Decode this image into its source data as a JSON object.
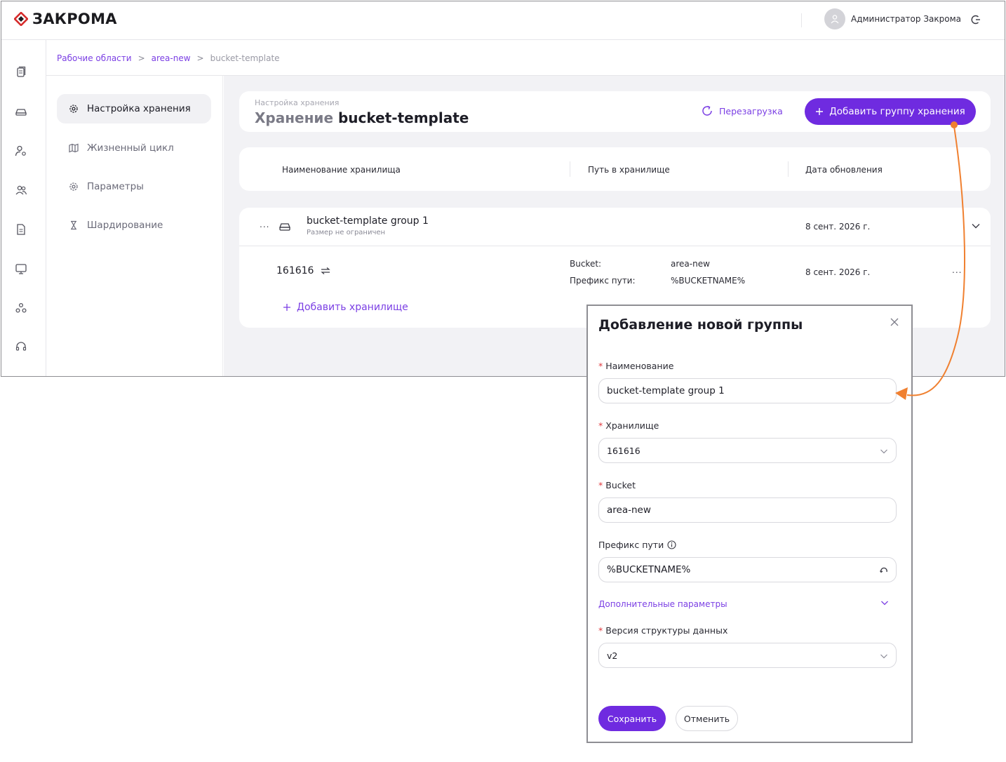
{
  "brand": {
    "name": "ЗАКРОМА",
    "accent": "#6f2be0",
    "logo_color": "#d62b2b"
  },
  "user": {
    "name": "Администратор Закрома"
  },
  "sidebar": {
    "icons": [
      "documents-icon",
      "storage-icon",
      "user-settings-icon",
      "users-icon",
      "file-icon",
      "monitor-icon",
      "cluster-icon",
      "support-icon"
    ]
  },
  "breadcrumb": {
    "items": [
      "Рабочие области",
      "area-new",
      "bucket-template"
    ],
    "separator": ">"
  },
  "leftnav": {
    "items": [
      "Настройка хранения",
      "Жизненный цикл",
      "Параметры",
      "Шардирование"
    ]
  },
  "header": {
    "subtitle": "Настройка хранения",
    "title_prefix": "Хранение",
    "title_name": "bucket-template",
    "reload_label": "Перезагрузка",
    "add_group_label": "Добавить группу хранения"
  },
  "table": {
    "columns": [
      "Наименование хранилища",
      "Путь в хранилище",
      "Дата обновления"
    ]
  },
  "group": {
    "menu": "...",
    "name": "bucket-template group 1",
    "size_note": "Размер не ограничен",
    "date": "8 сент. 2026 г.",
    "storage": {
      "name": "161616",
      "bucket_label": "Bucket:",
      "bucket_value": "area-new",
      "prefix_label": "Префикс пути:",
      "prefix_value": "%BUCKETNAME%",
      "date": "8 сент. 2026 г.",
      "menu": "..."
    },
    "add_storage_label": "Добавить хранилище"
  },
  "modal": {
    "title": "Добавление новой группы",
    "required_mark": "*",
    "fields": {
      "name_label": "Наименование",
      "name_value": "bucket-template group 1",
      "storage_label": "Хранилище",
      "storage_value": "161616",
      "bucket_label": "Bucket",
      "bucket_value": "area-new",
      "prefix_label": "Префикс пути",
      "prefix_value": "%BUCKETNAME%",
      "extra_label": "Дополнительные параметры",
      "version_label": "Версия структуры данных",
      "version_value": "v2"
    },
    "save_label": "Сохранить",
    "cancel_label": "Отменить"
  },
  "annotation": {
    "arrow_color": "#f08030"
  }
}
